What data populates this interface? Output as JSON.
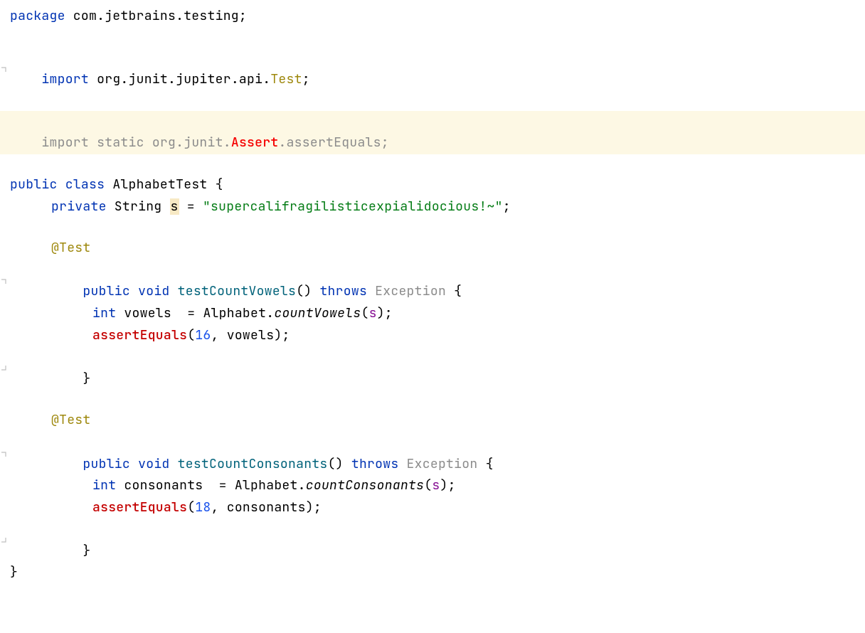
{
  "code": {
    "package_kw": "package",
    "package_name": " com.jetbrains.testing",
    "semi": ";",
    "import_kw": "import",
    "import1_pkg": " org.junit.jupiter.api.",
    "import1_cls": "Test",
    "static_kw": "static",
    "import2_pkg": " org.junit.",
    "import2_err": "Assert",
    "import2_dot": ".",
    "import2_method": "assertEquals",
    "public_kw": "public",
    "class_kw": "class",
    "class_name": " AlphabetTest ",
    "brace_open": "{",
    "brace_close": "}",
    "private_kw": "private",
    "string_type": " String ",
    "field_s": "s",
    "eq": " = ",
    "string_val": "\"supercalifragilisticexpialidocious!~\"",
    "test_ann": "@Test",
    "void_kw": "void",
    "method1_name": " testCountVowels",
    "throws_kw": "throws",
    "exception": " Exception ",
    "int_kw": "int",
    "var_vowels": " vowels ",
    "alphabet_cls": "Alphabet",
    "countVowels": "countVowels",
    "s_arg": "s",
    "assertEquals": "assertEquals",
    "sixteen": "16",
    "vowels_arg": " vowels",
    "comma": ",",
    "method2_name": " testCountConsonants",
    "var_consonants": " consonants ",
    "countConsonants": "countConsonants",
    "eighteen": "18",
    "consonants_arg": " consonants",
    "paren_open": "(",
    "paren_close": ")",
    "empty_parens": "()",
    "space": " "
  },
  "icons": {
    "bulb": "bulb-icon"
  }
}
